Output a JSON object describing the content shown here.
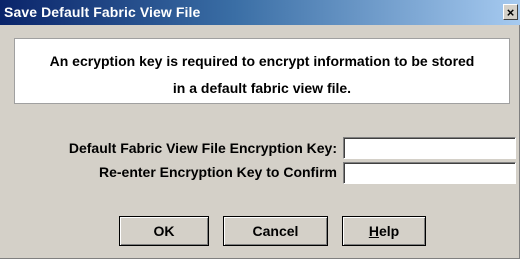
{
  "window": {
    "title": "Save Default Fabric View File",
    "close_glyph": "×"
  },
  "message": {
    "line1": "An ecryption key is required to encrypt information to be stored",
    "line2": "in a default fabric view file."
  },
  "form": {
    "encryption_key_label": "Default Fabric View File Encryption Key:",
    "encryption_key_value": "",
    "confirm_key_label": "Re-enter Encryption Key to Confirm",
    "confirm_key_value": ""
  },
  "buttons": {
    "ok": "OK",
    "cancel": "Cancel",
    "help_mnemonic": "H",
    "help_rest": "elp"
  }
}
